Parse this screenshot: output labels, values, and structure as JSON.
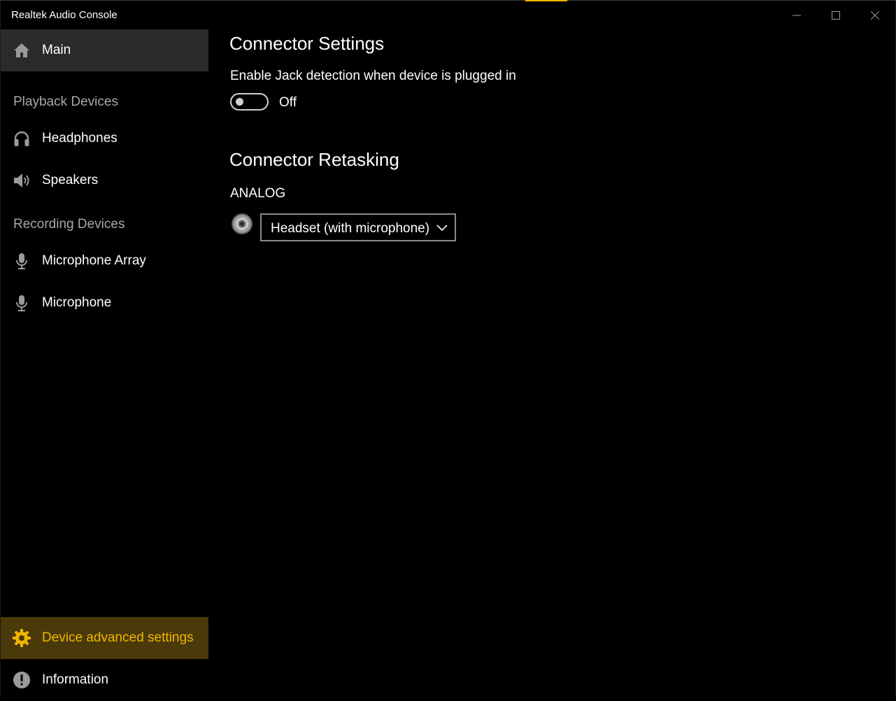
{
  "window": {
    "title": "Realtek Audio Console",
    "accent_color": "#f2b400",
    "caption_buttons": {
      "minimize_icon": "minimize-icon",
      "maximize_icon": "maximize-icon",
      "close_icon": "close-icon"
    }
  },
  "sidebar": {
    "main": {
      "label": "Main",
      "icon": "home-icon"
    },
    "playback_header": "Playback Devices",
    "playback_items": [
      {
        "label": "Headphones",
        "icon": "headphones-icon"
      },
      {
        "label": "Speakers",
        "icon": "speaker-icon"
      }
    ],
    "recording_header": "Recording Devices",
    "recording_items": [
      {
        "label": "Microphone Array",
        "icon": "microphone-icon"
      },
      {
        "label": "Microphone",
        "icon": "microphone-icon"
      }
    ],
    "advanced": {
      "label": "Device advanced settings",
      "icon": "gear-icon",
      "selected": true,
      "highlight_color": "#4a3a0a"
    },
    "information": {
      "label": "Information",
      "icon": "info-icon"
    }
  },
  "content": {
    "connector_settings": {
      "title": "Connector Settings",
      "jack_detection_label": "Enable Jack detection when device is plugged in",
      "toggle_state": "Off"
    },
    "connector_retasking": {
      "title": "Connector Retasking",
      "group_label": "ANALOG",
      "jack_icon": "audio-jack-icon",
      "selected_option": "Headset (with microphone)"
    }
  }
}
